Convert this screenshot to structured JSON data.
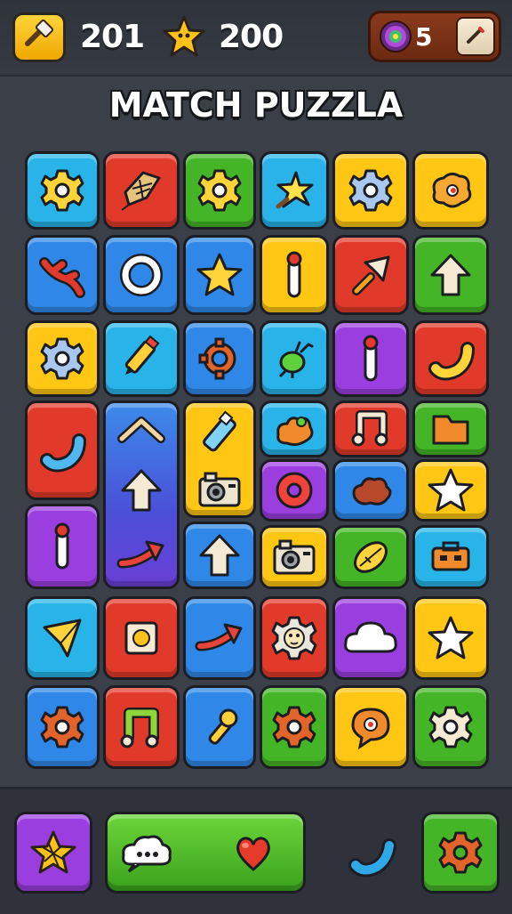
{
  "hud": {
    "tool_icon": "hammer-icon",
    "coins": "201",
    "star_icon": "star-icon",
    "stars": "200",
    "lives_icon": "swirl-orb-icon",
    "lives": "5",
    "edit_icon": "pencil-icon"
  },
  "title": "MATCH PUZZLA",
  "colors": {
    "blue": "#2f88e8",
    "cyan": "#28b4e8",
    "red": "#e23a2a",
    "green": "#44b526",
    "yellow": "#ffc713",
    "purple": "#9b3ee0"
  },
  "board": {
    "tiles": [
      {
        "color": "cyan",
        "icon": "gear-icon"
      },
      {
        "color": "red",
        "icon": "kite-icon"
      },
      {
        "color": "green",
        "icon": "gear-icon"
      },
      {
        "color": "cyan",
        "icon": "star-burst-icon"
      },
      {
        "color": "yellow",
        "icon": "gear-icon"
      },
      {
        "color": "yellow",
        "icon": "blob-eye-icon"
      },
      {
        "color": "blue",
        "icon": "branch-icon"
      },
      {
        "color": "blue",
        "icon": "ring-icon"
      },
      {
        "color": "blue",
        "icon": "star-icon"
      },
      {
        "color": "yellow",
        "icon": "pin-icon"
      },
      {
        "color": "red",
        "icon": "arrow-cursor-icon"
      },
      {
        "color": "green",
        "icon": "arrow-up-icon"
      },
      {
        "color": "yellow",
        "icon": "gear-icon"
      },
      {
        "color": "cyan",
        "icon": "pencil-icon"
      },
      {
        "color": "blue",
        "icon": "gear-ring-icon"
      },
      {
        "color": "cyan",
        "icon": "bug-icon"
      },
      {
        "color": "purple",
        "icon": "pin-icon"
      },
      {
        "color": "red",
        "icon": "phone-icon"
      },
      {
        "color": "red",
        "icon": "phone-icon"
      },
      {
        "color": "blue",
        "icon": "chevron-up-icon"
      },
      {
        "color": "yellow",
        "icon": "usb-stick-icon"
      },
      {
        "color": "cyan",
        "icon": "blob-icon"
      },
      {
        "color": "red",
        "icon": "music-note-icon"
      },
      {
        "color": "green",
        "icon": "folder-icon"
      },
      {
        "color": "purple",
        "icon": "donut-icon"
      },
      {
        "color": "blue",
        "icon": "cloud-blob-icon"
      },
      {
        "color": "yellow",
        "icon": "star-icon"
      },
      {
        "color": "purple",
        "icon": "pin-icon"
      },
      {
        "color": "blue",
        "icon": "arrow-up-icon"
      },
      {
        "color": "yellow",
        "icon": "camera-icon"
      },
      {
        "color": "green",
        "icon": "leaf-icon"
      },
      {
        "color": "cyan",
        "icon": "toolbox-icon"
      },
      {
        "color": "cyan",
        "icon": "paper-plane-icon"
      },
      {
        "color": "red",
        "icon": "square-icon"
      },
      {
        "color": "blue",
        "icon": "arrow-right-icon"
      },
      {
        "color": "red",
        "icon": "gear-face-icon"
      },
      {
        "color": "purple",
        "icon": "cloud-icon"
      },
      {
        "color": "yellow",
        "icon": "star-icon"
      },
      {
        "color": "blue",
        "icon": "gear-icon"
      },
      {
        "color": "red",
        "icon": "music-note-icon"
      },
      {
        "color": "blue",
        "icon": "microphone-icon"
      },
      {
        "color": "green",
        "icon": "gear-icon"
      },
      {
        "color": "yellow",
        "icon": "speech-bubble-icon"
      },
      {
        "color": "green",
        "icon": "gear-icon"
      },
      {
        "color": "purple",
        "icon": "gear-icon"
      },
      {
        "color": "cyan",
        "icon": "pencil-icon"
      },
      {
        "color": "purple",
        "icon": "question-mark-icon"
      }
    ]
  },
  "powerups": {
    "left_icon": "star-scribble-icon",
    "wide_left_icon": "chat-cloud-icon",
    "wide_right_icon": "heart-icon",
    "loose_icon": "phone-icon",
    "right_icon": "gear-icon"
  }
}
